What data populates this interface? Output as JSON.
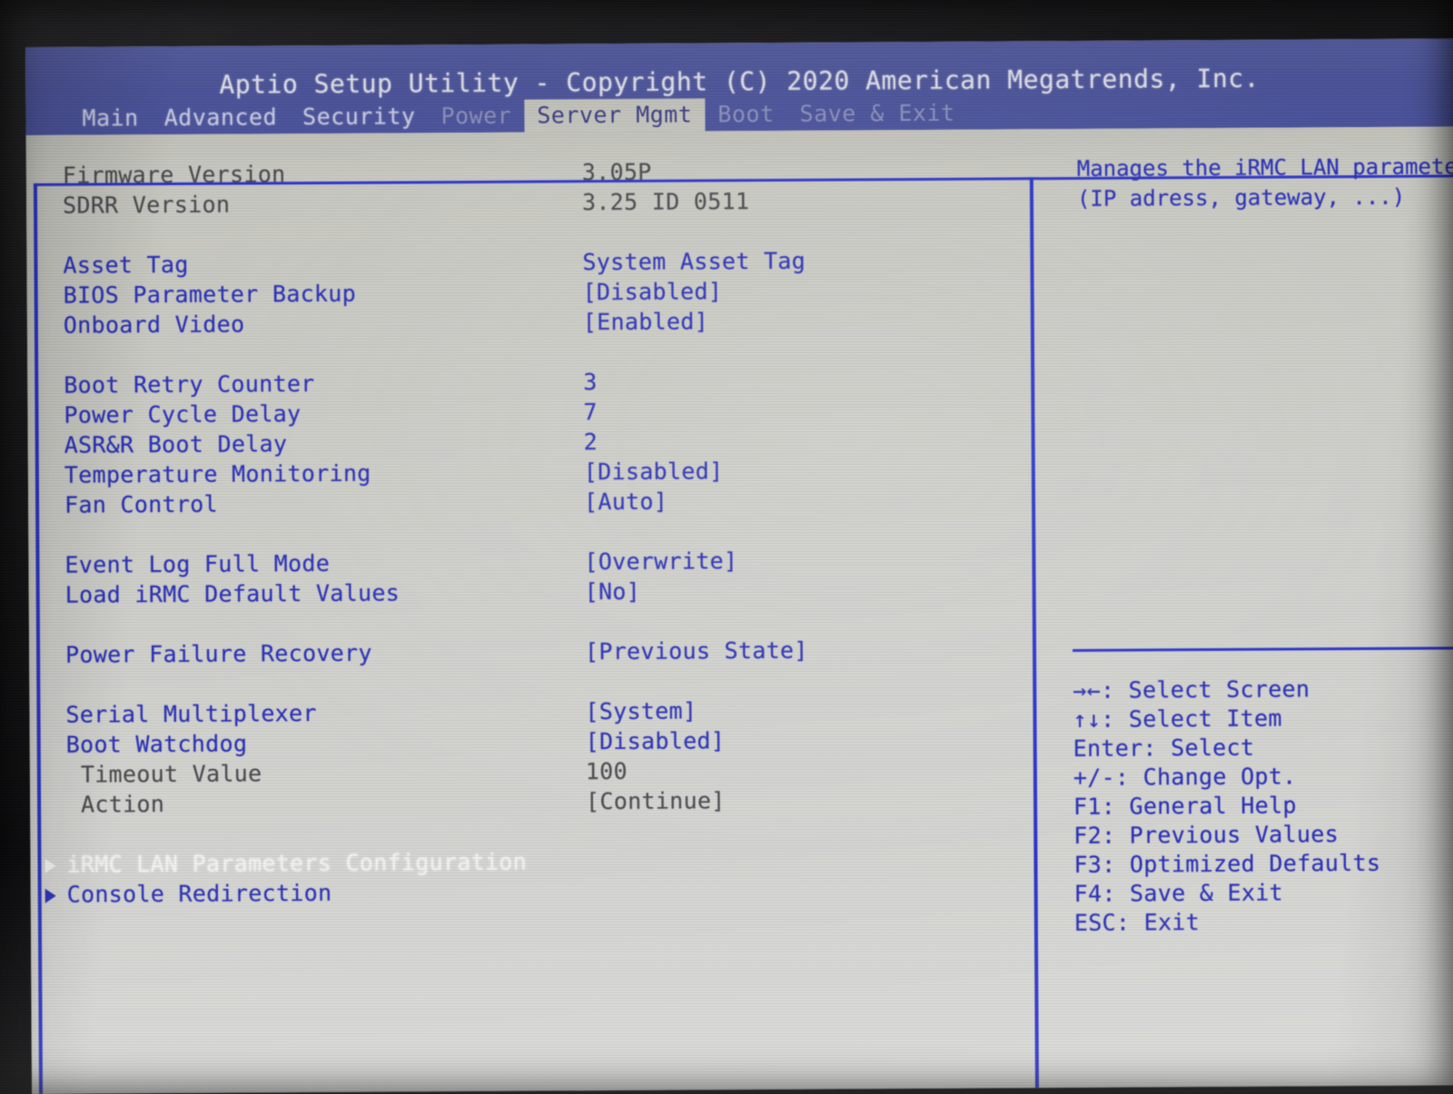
{
  "title": "Aptio Setup Utility - Copyright (C) 2020 American Megatrends, Inc.",
  "menu": {
    "tabs": [
      {
        "label": "Main",
        "state": "normal"
      },
      {
        "label": "Advanced",
        "state": "normal"
      },
      {
        "label": "Security",
        "state": "normal"
      },
      {
        "label": "Power",
        "state": "dim"
      },
      {
        "label": "Server Mgmt",
        "state": "active"
      },
      {
        "label": "Boot",
        "state": "dim"
      },
      {
        "label": "Save & Exit",
        "state": "dim"
      }
    ]
  },
  "settings": [
    {
      "label": "Firmware Version",
      "value": "3.05P",
      "style": "gray",
      "type": "info"
    },
    {
      "label": "SDRR Version",
      "value": "3.25 ID 0511",
      "style": "gray",
      "type": "info"
    },
    {
      "type": "spacer"
    },
    {
      "label": "Asset Tag",
      "value": "System Asset Tag",
      "style": "blue",
      "type": "text"
    },
    {
      "label": "BIOS Parameter Backup",
      "value": "[Disabled]",
      "style": "blue",
      "type": "option"
    },
    {
      "label": "Onboard Video",
      "value": "[Enabled]",
      "style": "blue",
      "type": "option"
    },
    {
      "type": "spacer"
    },
    {
      "label": "Boot Retry Counter",
      "value": "3",
      "style": "blue",
      "type": "number"
    },
    {
      "label": "Power Cycle Delay",
      "value": "7",
      "style": "blue",
      "type": "number"
    },
    {
      "label": "ASR&R Boot Delay",
      "value": "2",
      "style": "blue",
      "type": "number"
    },
    {
      "label": "Temperature Monitoring",
      "value": "[Disabled]",
      "style": "blue",
      "type": "option"
    },
    {
      "label": "Fan Control",
      "value": "[Auto]",
      "style": "blue",
      "type": "option"
    },
    {
      "type": "spacer"
    },
    {
      "label": "Event Log Full Mode",
      "value": "[Overwrite]",
      "style": "blue",
      "type": "option"
    },
    {
      "label": "Load iRMC Default Values",
      "value": "[No]",
      "style": "blue",
      "type": "option"
    },
    {
      "type": "spacer"
    },
    {
      "label": "Power Failure Recovery",
      "value": "[Previous State]",
      "style": "blue",
      "type": "option"
    },
    {
      "type": "spacer"
    },
    {
      "label": "Serial Multiplexer",
      "value": "[System]",
      "style": "blue",
      "type": "option"
    },
    {
      "label": "Boot Watchdog",
      "value": "[Disabled]",
      "style": "blue",
      "type": "option"
    },
    {
      "label": "Timeout Value",
      "value": "100",
      "style": "gray",
      "type": "number",
      "indent": true
    },
    {
      "label": "Action",
      "value": "[Continue]",
      "style": "gray",
      "type": "option",
      "indent": true
    },
    {
      "type": "spacer"
    },
    {
      "label": "iRMC LAN Parameters Configuration",
      "value": "",
      "style": "white",
      "type": "submenu",
      "selected": true
    },
    {
      "label": "Console Redirection",
      "value": "",
      "style": "blue",
      "type": "submenu",
      "selected": false
    }
  ],
  "help": {
    "lines": [
      "Manages the iRMC LAN parameters.",
      "(IP adress, gateway, ...)"
    ]
  },
  "keys": [
    {
      "key": "→←",
      "action": ": Select Screen"
    },
    {
      "key": "↑↓",
      "action": ": Select Item"
    },
    {
      "key": "Enter",
      "action": ": Select"
    },
    {
      "key": "+/-",
      "action": ": Change Opt."
    },
    {
      "key": "F1",
      "action": ": General Help"
    },
    {
      "key": "F2",
      "action": ": Previous Values"
    },
    {
      "key": "F3",
      "action": ": Optimized Defaults"
    },
    {
      "key": "F4",
      "action": ": Save & Exit"
    },
    {
      "key": "ESC",
      "action": ": Exit"
    }
  ],
  "colors": {
    "accent_blue": "#2a31b6",
    "frame_blue": "#2b34c8",
    "titlebar_blue": "#5159a2",
    "screen_bg": "#c9c9c2",
    "selected_text": "#f2f2ef",
    "readonly_gray": "#4b4b50"
  }
}
